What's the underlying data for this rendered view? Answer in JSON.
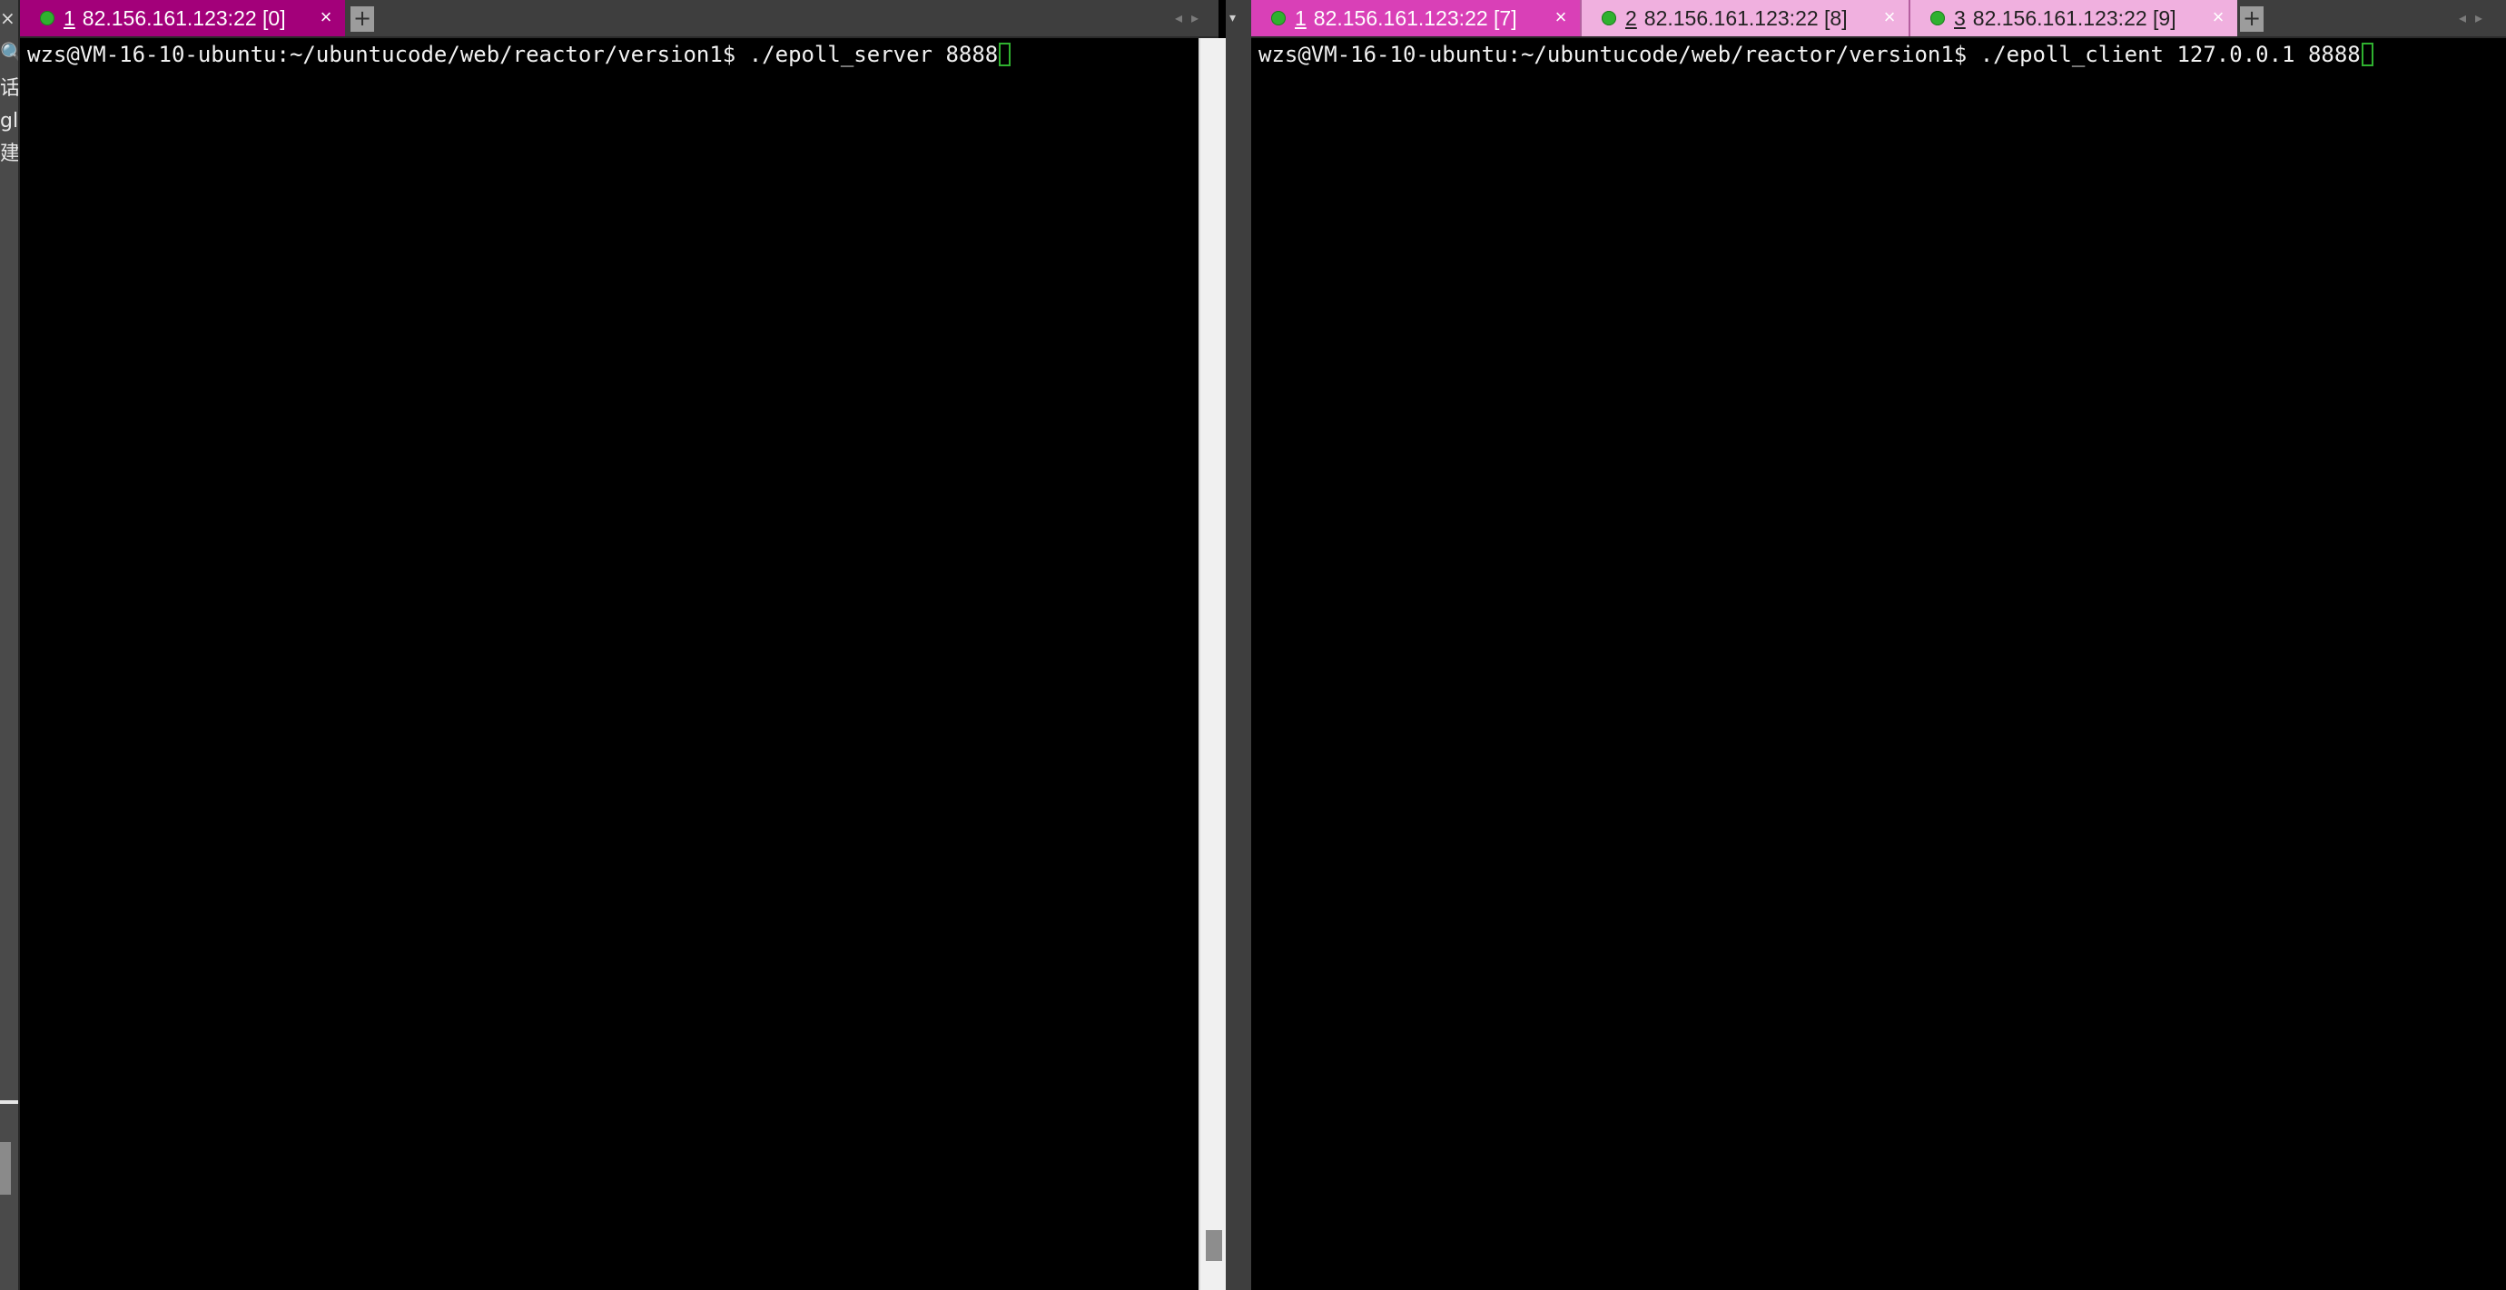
{
  "left_sliver": {
    "close_glyph": "×",
    "search_glyph": "🔍",
    "text1": "话",
    "text2": "gli",
    "text3": "建s"
  },
  "left_pane": {
    "tabs": [
      {
        "number": "1",
        "label": "82.156.161.123:22 [0]",
        "close": "×",
        "state": "active"
      }
    ],
    "add_tab": "+",
    "nav_prev": "◂",
    "nav_next": "▸",
    "dropdown": "▾",
    "terminal": {
      "prompt": "wzs@VM-16-10-ubuntu:~/ubuntucode/web/reactor/version1$",
      "command": " ./epoll_server 8888"
    }
  },
  "right_pane": {
    "tabs": [
      {
        "number": "1",
        "label": "82.156.161.123:22 [7]",
        "close": "×",
        "state": "active"
      },
      {
        "number": "2",
        "label": "82.156.161.123:22 [8]",
        "close": "×",
        "state": "inactive"
      },
      {
        "number": "3",
        "label": "82.156.161.123:22 [9]",
        "close": "×",
        "state": "inactive"
      }
    ],
    "add_tab": "+",
    "nav_prev": "◂",
    "nav_next": "▸",
    "terminal": {
      "prompt": "wzs@VM-16-10-ubuntu:~/ubuntucode/web/reactor/version1$",
      "command": " ./epoll_client 127.0.0.1 8888"
    }
  },
  "colors": {
    "left_active_tab": "#a3007a",
    "right_active_tab": "#d940b7",
    "inactive_tab": "#f0b0df",
    "connected_dot": "#2fb12f",
    "cursor": "#2fb12f"
  },
  "icons": {
    "status_dot": "connected-status-icon",
    "close": "close-icon",
    "add": "add-tab-icon",
    "nav": "tab-scroll-arrow-icon",
    "dropdown": "tab-list-dropdown-icon"
  }
}
